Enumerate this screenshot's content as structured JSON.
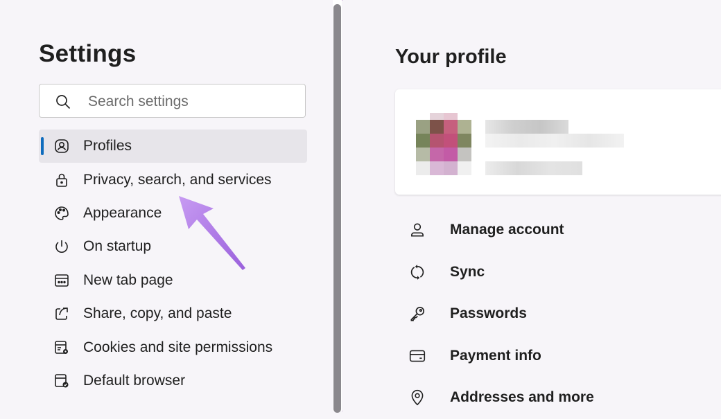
{
  "sidebar": {
    "title": "Settings",
    "search": {
      "placeholder": "Search settings",
      "value": ""
    },
    "items": [
      {
        "label": "Profiles",
        "icon": "profile-icon",
        "active": true
      },
      {
        "label": "Privacy, search, and services",
        "icon": "lock-icon"
      },
      {
        "label": "Appearance",
        "icon": "palette-icon"
      },
      {
        "label": "On startup",
        "icon": "power-icon"
      },
      {
        "label": "New tab page",
        "icon": "new-tab-icon"
      },
      {
        "label": "Share, copy, and paste",
        "icon": "share-icon"
      },
      {
        "label": "Cookies and site permissions",
        "icon": "cookies-icon"
      },
      {
        "label": "Default browser",
        "icon": "default-browser-icon"
      }
    ]
  },
  "main": {
    "title": "Your profile",
    "menu": [
      {
        "label": "Manage account",
        "icon": "person-icon"
      },
      {
        "label": "Sync",
        "icon": "sync-icon"
      },
      {
        "label": "Passwords",
        "icon": "key-icon"
      },
      {
        "label": "Payment info",
        "icon": "card-icon"
      },
      {
        "label": "Addresses and more",
        "icon": "location-icon"
      }
    ]
  },
  "colors": {
    "accent": "#0f6cbd",
    "annotation_arrow": "#a66de0",
    "scrollbar_thumb": "#8a888d"
  }
}
